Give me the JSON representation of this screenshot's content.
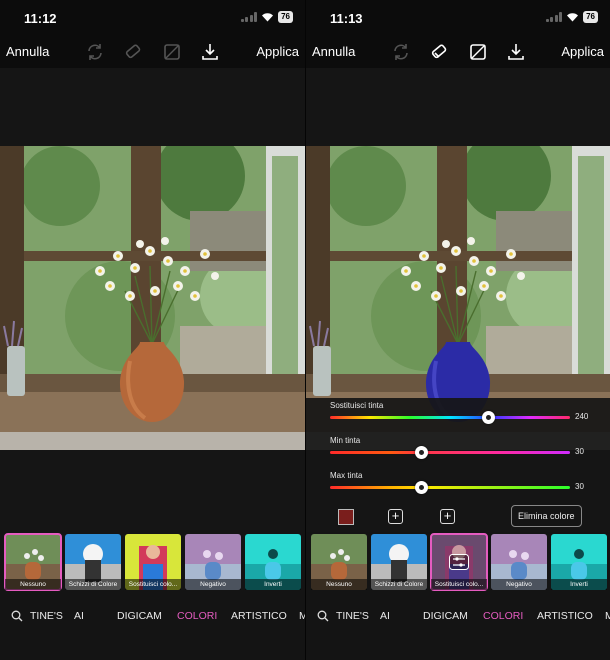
{
  "left": {
    "status": {
      "time": "11:12",
      "battery": "76"
    },
    "toolbar": {
      "cancel": "Annulla",
      "apply": "Applica"
    },
    "filters": [
      {
        "label": "Nessuno",
        "selected": true,
        "style": "none"
      },
      {
        "label": "Schizzi di Colore",
        "selected": false,
        "style": "bw"
      },
      {
        "label": "Sostituisci colo...",
        "selected": false,
        "style": "replace"
      },
      {
        "label": "Negativo",
        "selected": false,
        "style": "negative"
      },
      {
        "label": "Inverti",
        "selected": false,
        "style": "invert"
      }
    ],
    "categories": [
      "TINE'S",
      "AI",
      "DIGICAM",
      "COLORI",
      "ARTISTICO",
      "M"
    ],
    "active_category": "COLORI"
  },
  "right": {
    "status": {
      "time": "11:13",
      "battery": "76"
    },
    "toolbar": {
      "cancel": "Annulla",
      "apply": "Applica"
    },
    "sliders": [
      {
        "label": "Sostituisci tinta",
        "value": "240",
        "position": 0.66
      },
      {
        "label": "Min tinta",
        "value": "30",
        "position": 0.38
      },
      {
        "label": "Max tinta",
        "value": "30",
        "position": 0.38
      }
    ],
    "swatch_color": "#7a1e1c",
    "delete_color_label": "Elimina colore",
    "filters": [
      {
        "label": "Nessuno",
        "selected": false,
        "style": "none"
      },
      {
        "label": "Schizzi di Colore",
        "selected": false,
        "style": "bw"
      },
      {
        "label": "Sostituisci colo...",
        "selected": true,
        "style": "replace"
      },
      {
        "label": "Negativo",
        "selected": false,
        "style": "negative"
      },
      {
        "label": "Inverti",
        "selected": false,
        "style": "invert"
      }
    ],
    "categories": [
      "TINE'S",
      "AI",
      "DIGICAM",
      "COLORI",
      "ARTISTICO",
      "M"
    ],
    "active_category": "COLORI"
  },
  "colors": {
    "accent": "#e55cc0",
    "vase_original": "#b5683a",
    "vase_replaced": "#2b2ba6"
  }
}
